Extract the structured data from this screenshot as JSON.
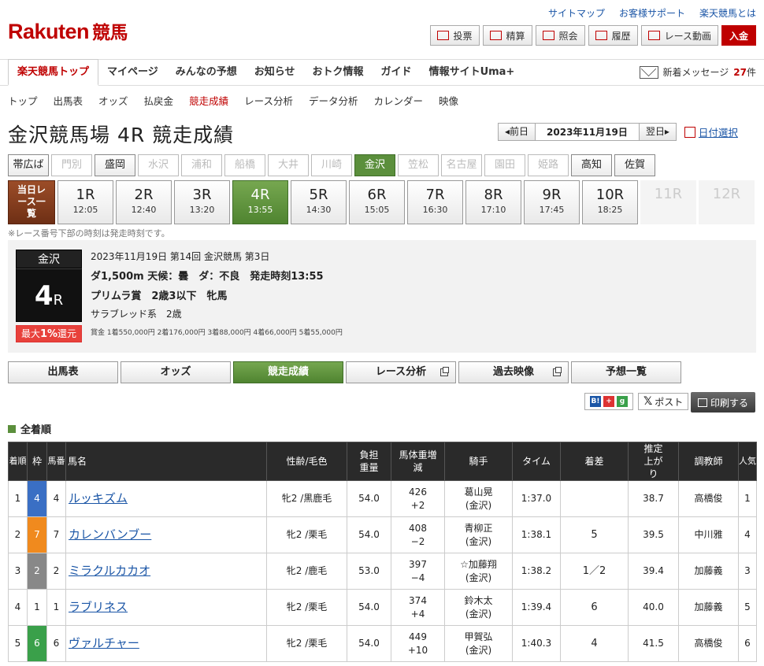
{
  "header": {
    "logo_text": "Rakuten",
    "logo_sub": "競馬",
    "links": [
      "サイトマップ",
      "お客様サポート",
      "楽天競馬とは"
    ],
    "actions": [
      "投票",
      "精算",
      "照会",
      "履歴",
      "レース動画"
    ],
    "deposit": "入金"
  },
  "gnav": {
    "items": [
      "楽天競馬トップ",
      "マイページ",
      "みんなの予想",
      "お知らせ",
      "おトク情報",
      "ガイド",
      "情報サイトUma+"
    ],
    "message_label": "新着メッセージ",
    "message_count": "27",
    "message_unit": "件"
  },
  "subnav": {
    "items": [
      "トップ",
      "出馬表",
      "オッズ",
      "払戻金",
      "競走成績",
      "レース分析",
      "データ分析",
      "カレンダー",
      "映像"
    ]
  },
  "page": {
    "title": "金沢競馬場 4R 競走成績",
    "prev": "前日",
    "date": "2023年11月19日",
    "next": "翌日",
    "date_select": "日付選択",
    "note": "※レース番号下部の時刻は発走時刻です。"
  },
  "venues": [
    "帯広ば",
    "門別",
    "盛岡",
    "水沢",
    "浦和",
    "船橋",
    "大井",
    "川崎",
    "金沢",
    "笠松",
    "名古屋",
    "園田",
    "姫路",
    "高知",
    "佐賀"
  ],
  "races": {
    "today_label": "当日レース一覧",
    "items": [
      {
        "n": "1R",
        "t": "12:05"
      },
      {
        "n": "2R",
        "t": "12:40"
      },
      {
        "n": "3R",
        "t": "13:20"
      },
      {
        "n": "4R",
        "t": "13:55"
      },
      {
        "n": "5R",
        "t": "14:30"
      },
      {
        "n": "6R",
        "t": "15:05"
      },
      {
        "n": "7R",
        "t": "16:30"
      },
      {
        "n": "8R",
        "t": "17:10"
      },
      {
        "n": "9R",
        "t": "17:45"
      },
      {
        "n": "10R",
        "t": "18:25"
      },
      {
        "n": "11R",
        "t": ""
      },
      {
        "n": "12R",
        "t": ""
      }
    ]
  },
  "race_info": {
    "venue": "金沢",
    "num": "4",
    "r": "R",
    "cashback_pre": "最大",
    "cashback_pct": "1%",
    "cashback_post": "還元",
    "line1": "2023年11月19日 第14回 金沢競馬 第3日",
    "line2": "ダ1,500m 天候：曇　ダ：不良　発走時刻13:55",
    "line3": "プリムラ賞　2歳3以下　牝馬",
    "line4": "サラブレッド系　2歳",
    "prizes": "賞金 1着550,000円 2着176,000円 3着88,000円 4着66,000円 5着55,000円"
  },
  "tabs": [
    "出馬表",
    "オッズ",
    "競走成績",
    "レース分析",
    "過去映像",
    "予想一覧"
  ],
  "share": {
    "post": "ポスト",
    "print": "印刷する"
  },
  "results": {
    "section_title": "全着順",
    "headers": [
      "着順",
      "枠",
      "馬番",
      "馬名",
      "性齢/毛色",
      "負担重量",
      "馬体重増減",
      "騎手",
      "タイム",
      "着差",
      "推定上がり",
      "調教師",
      "人気"
    ],
    "rows": [
      {
        "rank": "1",
        "waku": "4",
        "umaban": "4",
        "name": "ルッキズム",
        "sex": "牝2 /黒鹿毛",
        "wt": "54.0",
        "bw": "426",
        "bd": "+2",
        "jk": "葛山晃",
        "jr": "(金沢)",
        "time": "1:37.0",
        "diff": "",
        "up": "38.7",
        "tr": "高橋俊",
        "pop": "1"
      },
      {
        "rank": "2",
        "waku": "7",
        "umaban": "7",
        "name": "カレンバンブー",
        "sex": "牝2 /栗毛",
        "wt": "54.0",
        "bw": "408",
        "bd": "−2",
        "jk": "青柳正",
        "jr": "(金沢)",
        "time": "1:38.1",
        "diff": "5",
        "up": "39.5",
        "tr": "中川雅",
        "pop": "4"
      },
      {
        "rank": "3",
        "waku": "2",
        "umaban": "2",
        "name": "ミラクルカカオ",
        "sex": "牝2 /鹿毛",
        "wt": "53.0",
        "bw": "397",
        "bd": "−4",
        "jk": "☆加藤翔",
        "jr": "(金沢)",
        "time": "1:38.2",
        "diff": "1／2",
        "up": "39.4",
        "tr": "加藤義",
        "pop": "3"
      },
      {
        "rank": "4",
        "waku": "1",
        "umaban": "1",
        "name": "ラブリネス",
        "sex": "牝2 /栗毛",
        "wt": "54.0",
        "bw": "374",
        "bd": "+4",
        "jk": "鈴木太",
        "jr": "(金沢)",
        "time": "1:39.4",
        "diff": "6",
        "up": "40.0",
        "tr": "加藤義",
        "pop": "5"
      },
      {
        "rank": "5",
        "waku": "6",
        "umaban": "6",
        "name": "ヴァルチャー",
        "sex": "牝2 /栗毛",
        "wt": "54.0",
        "bw": "449",
        "bd": "+10",
        "jk": "甲賀弘",
        "jr": "(金沢)",
        "time": "1:40.3",
        "diff": "4",
        "up": "41.5",
        "tr": "高橋俊",
        "pop": "6"
      }
    ]
  },
  "colors": {
    "brand": "#bf0000",
    "green": "#5b8f3c",
    "waku1": "#ffffff",
    "waku2": "#888888",
    "waku4": "#3a6fc4",
    "waku6": "#3aa04a",
    "waku7": "#f08a1e"
  }
}
